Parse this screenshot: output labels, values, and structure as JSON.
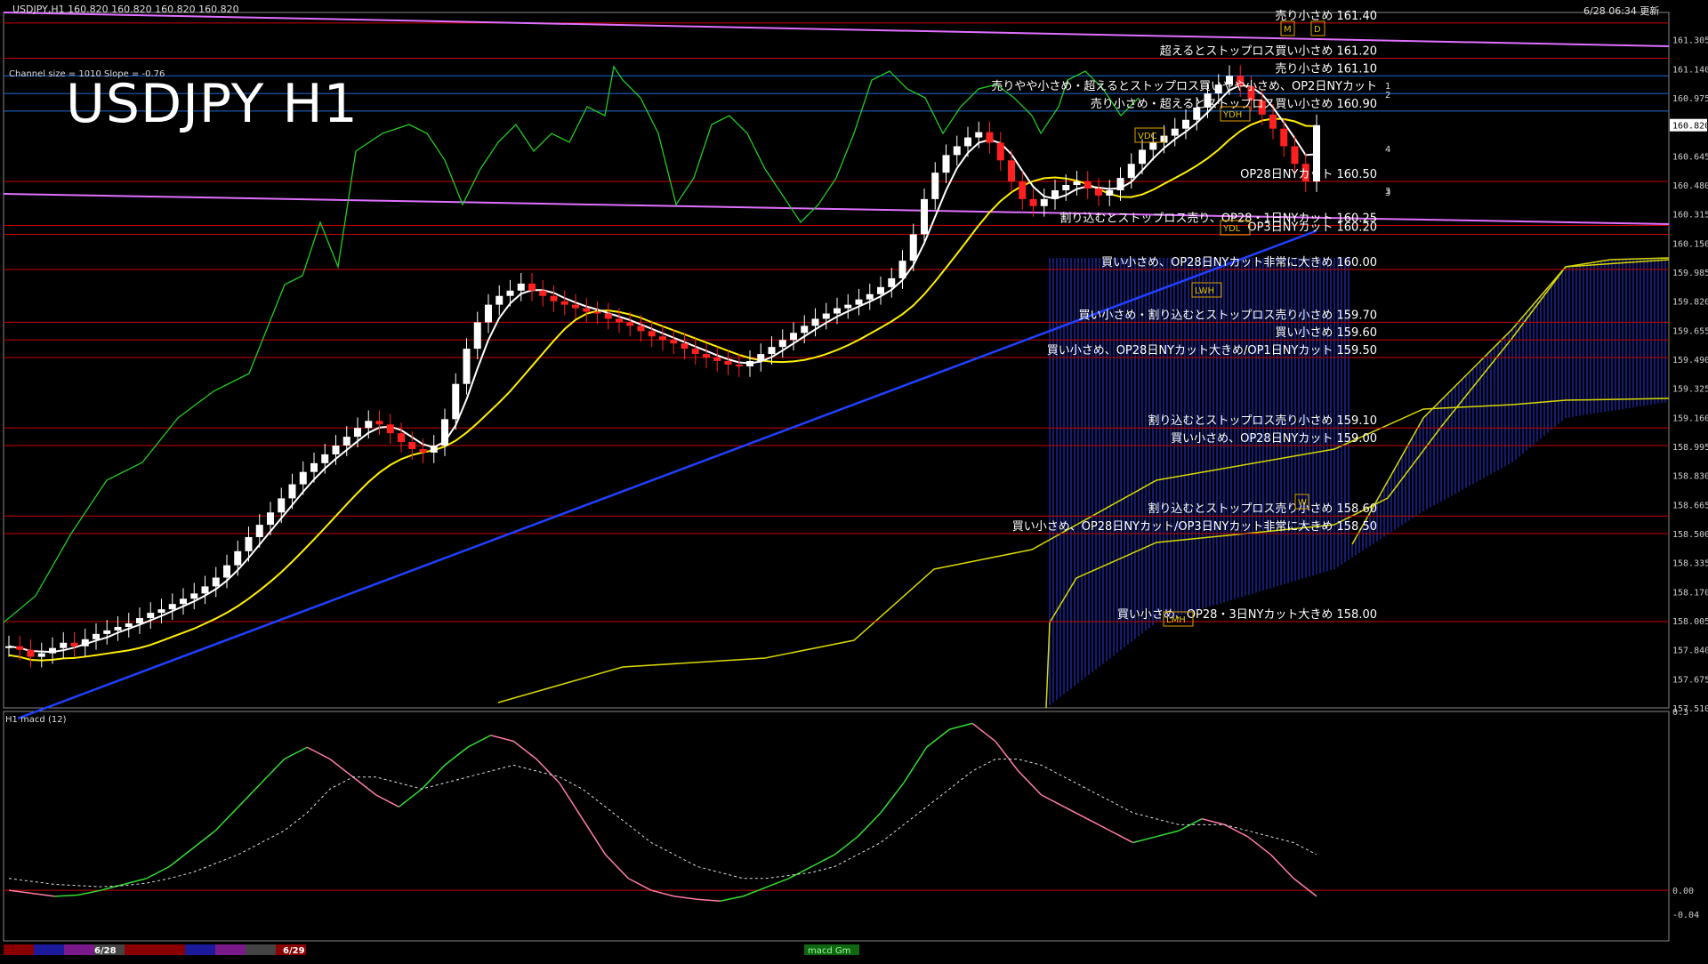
{
  "header": {
    "symbol_line": "USDJPY,H1  160.820 160.820 160.820 160.820",
    "updated": "6/28 06:34 更新",
    "channel_info": "Channel size = 1010 Slope = -0.76",
    "chart_title": "USDJPY H1",
    "macd_label": "H1  macd (12)"
  },
  "price_axis": {
    "ticks": [
      "161.305",
      "161.140",
      "160.975",
      "160.820",
      "160.645",
      "160.480",
      "160.315",
      "160.150",
      "159.985",
      "159.820",
      "159.655",
      "159.490",
      "159.325",
      "159.160",
      "158.995",
      "158.830",
      "158.665",
      "158.500",
      "158.335",
      "158.170",
      "158.005",
      "157.840",
      "157.675",
      "157.510"
    ],
    "current_price": "160.820"
  },
  "macd_axis": {
    "ticks": [
      "0.3",
      "0.00",
      "-0.04"
    ]
  },
  "time_axis": {
    "labels": [
      "6/28",
      "6/29"
    ],
    "scroll_label": "macd Gm"
  },
  "level_labels": [
    {
      "text": "売り小さめ 161.40",
      "price": 161.4
    },
    {
      "text": "超えるとストップロス買い小さめ 161.20",
      "price": 161.2
    },
    {
      "text": "売り小さめ 161.10",
      "price": 161.1
    },
    {
      "text": "売りやや小さめ・超えるとストップロス買いやや小さめ、OP2日NYカット",
      "price": 161.0
    },
    {
      "text": "売り小さめ・超えるとストップロス買い小さめ 160.90",
      "price": 160.9
    },
    {
      "text": "OP28日NYカット 160.50",
      "price": 160.5
    },
    {
      "text": "割り込むとストップロス売り、OP28・1日NYカット 160.25",
      "price": 160.25
    },
    {
      "text": "OP3日NYカット 160.20",
      "price": 160.2
    },
    {
      "text": "買い小さめ、OP28日NYカット非常に大きめ 160.00",
      "price": 160.0
    },
    {
      "text": "買い小さめ・割り込むとストップロス売り小さめ 159.70",
      "price": 159.7
    },
    {
      "text": "買い小さめ 159.60",
      "price": 159.6
    },
    {
      "text": "買い小さめ、OP28日NYカット大きめ/OP1日NYカット 159.50",
      "price": 159.5
    },
    {
      "text": "割り込むとストップロス売り小さめ 159.10",
      "price": 159.1
    },
    {
      "text": "買い小さめ、OP28日NYカット 159.00",
      "price": 159.0
    },
    {
      "text": "割り込むとストップロス売り小さめ 158.60",
      "price": 158.6
    },
    {
      "text": "買い小さめ、OP28日NYカット/OP3日NYカット非常に大きめ 158.50",
      "price": 158.5
    },
    {
      "text": "買い小さめ、OP28・3日NYカット大きめ 158.00",
      "price": 158.0
    }
  ],
  "markers": [
    "YDH",
    "YDL",
    "LWH",
    "LMH",
    "VDC",
    "W",
    "M",
    "D"
  ],
  "channel_numbers": [
    "1",
    "2",
    "3",
    "4",
    "3"
  ],
  "colors": {
    "background": "#000000",
    "level_red": "#c80000",
    "level_blue": "#1e6bd6",
    "level_violet": "#e070ff",
    "candle_up": "#ffffff",
    "candle_down": "#ff2020",
    "ma_white": "#ffffff",
    "ma_yellow": "#ffee00",
    "ma_blue": "#2040ff",
    "chikou_green": "#22cc22",
    "cloud_blue": "#2030c0",
    "cloud_edge": "#d8d800",
    "macd_up": "#33dd33",
    "macd_down": "#ff7da8",
    "signal": "#dddddd"
  },
  "chart_data": {
    "type": "candlestick",
    "symbol": "USDJPY",
    "timeframe": "H1",
    "price_range": [
      157.51,
      161.46
    ],
    "close_series": [
      157.86,
      157.84,
      157.8,
      157.82,
      157.85,
      157.88,
      157.86,
      157.9,
      157.93,
      157.95,
      157.97,
      157.99,
      158.02,
      158.05,
      158.07,
      158.1,
      158.13,
      158.16,
      158.2,
      158.25,
      158.32,
      158.4,
      158.48,
      158.55,
      158.62,
      158.7,
      158.78,
      158.85,
      158.9,
      158.95,
      159.0,
      159.05,
      159.1,
      159.14,
      159.12,
      159.07,
      159.02,
      158.98,
      158.96,
      159.0,
      159.15,
      159.35,
      159.55,
      159.7,
      159.8,
      159.85,
      159.88,
      159.92,
      159.88,
      159.85,
      159.82,
      159.8,
      159.78,
      159.76,
      159.75,
      159.72,
      159.7,
      159.68,
      159.65,
      159.62,
      159.6,
      159.58,
      159.55,
      159.52,
      159.5,
      159.48,
      159.46,
      159.45,
      159.48,
      159.52,
      159.56,
      159.6,
      159.64,
      159.68,
      159.72,
      159.75,
      159.78,
      159.8,
      159.83,
      159.86,
      159.9,
      159.95,
      160.05,
      160.2,
      160.4,
      160.55,
      160.65,
      160.7,
      160.75,
      160.78,
      160.72,
      160.62,
      160.5,
      160.4,
      160.36,
      160.4,
      160.45,
      160.48,
      160.5,
      160.46,
      160.42,
      160.45,
      160.52,
      160.6,
      160.68,
      160.72,
      160.76,
      160.8,
      160.85,
      160.92,
      161.0,
      161.05,
      161.1,
      161.04,
      160.96,
      160.88,
      160.8,
      160.7,
      160.6,
      160.5,
      160.82
    ],
    "macd_series": [
      0.0,
      -0.005,
      -0.01,
      -0.008,
      0.0,
      0.01,
      0.02,
      0.04,
      0.07,
      0.1,
      0.14,
      0.18,
      0.22,
      0.24,
      0.22,
      0.19,
      0.16,
      0.14,
      0.17,
      0.21,
      0.24,
      0.26,
      0.25,
      0.22,
      0.18,
      0.12,
      0.06,
      0.02,
      0.0,
      -0.01,
      -0.015,
      -0.018,
      -0.01,
      0.005,
      0.02,
      0.04,
      0.06,
      0.09,
      0.13,
      0.18,
      0.24,
      0.27,
      0.28,
      0.25,
      0.2,
      0.16,
      0.14,
      0.12,
      0.1,
      0.08,
      0.09,
      0.1,
      0.12,
      0.11,
      0.09,
      0.06,
      0.02,
      -0.01
    ],
    "signal_series": [
      0.02,
      0.015,
      0.01,
      0.008,
      0.006,
      0.008,
      0.012,
      0.02,
      0.03,
      0.045,
      0.06,
      0.08,
      0.1,
      0.13,
      0.17,
      0.19,
      0.19,
      0.18,
      0.17,
      0.18,
      0.19,
      0.2,
      0.21,
      0.2,
      0.19,
      0.17,
      0.14,
      0.11,
      0.08,
      0.06,
      0.04,
      0.03,
      0.02,
      0.02,
      0.025,
      0.03,
      0.04,
      0.06,
      0.08,
      0.11,
      0.14,
      0.17,
      0.2,
      0.22,
      0.22,
      0.21,
      0.19,
      0.17,
      0.15,
      0.13,
      0.12,
      0.11,
      0.11,
      0.11,
      0.1,
      0.09,
      0.08,
      0.06
    ]
  }
}
